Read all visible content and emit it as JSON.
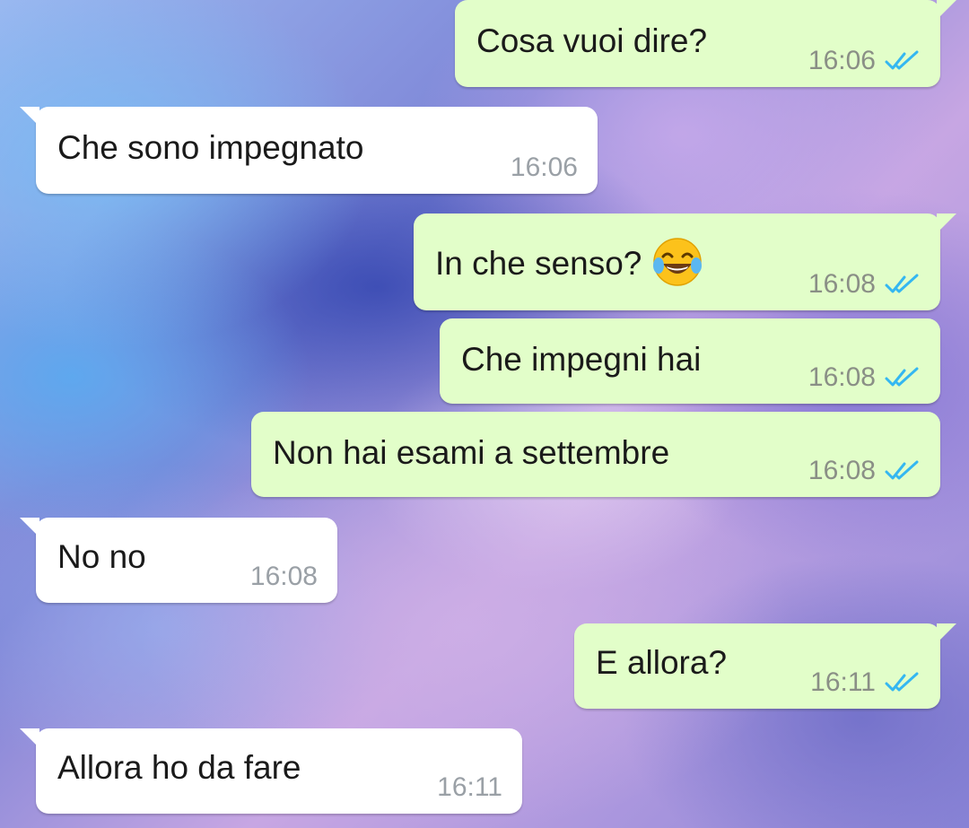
{
  "messages": [
    {
      "direction": "out",
      "text": "Cosa vuoi dire?",
      "time": "16:06",
      "status": "read"
    },
    {
      "direction": "in",
      "text": "Che sono impegnato",
      "time": "16:06"
    },
    {
      "direction": "out",
      "text": "In che senso?",
      "emoji": "face-with-tears-of-joy",
      "time": "16:08",
      "status": "read"
    },
    {
      "direction": "out",
      "text": "Che impegni hai",
      "time": "16:08",
      "status": "read"
    },
    {
      "direction": "out",
      "text": "Non hai esami a settembre",
      "time": "16:08",
      "status": "read"
    },
    {
      "direction": "in",
      "text": "No no",
      "time": "16:08"
    },
    {
      "direction": "out",
      "text": "E allora?",
      "time": "16:11",
      "status": "read"
    },
    {
      "direction": "in",
      "text": "Allora ho da fare",
      "time": "16:11"
    }
  ],
  "colors": {
    "outgoing_bubble": "#e2fec9",
    "incoming_bubble": "#ffffff",
    "read_ticks": "#34b7f1",
    "timestamp": "#8a8f86"
  }
}
